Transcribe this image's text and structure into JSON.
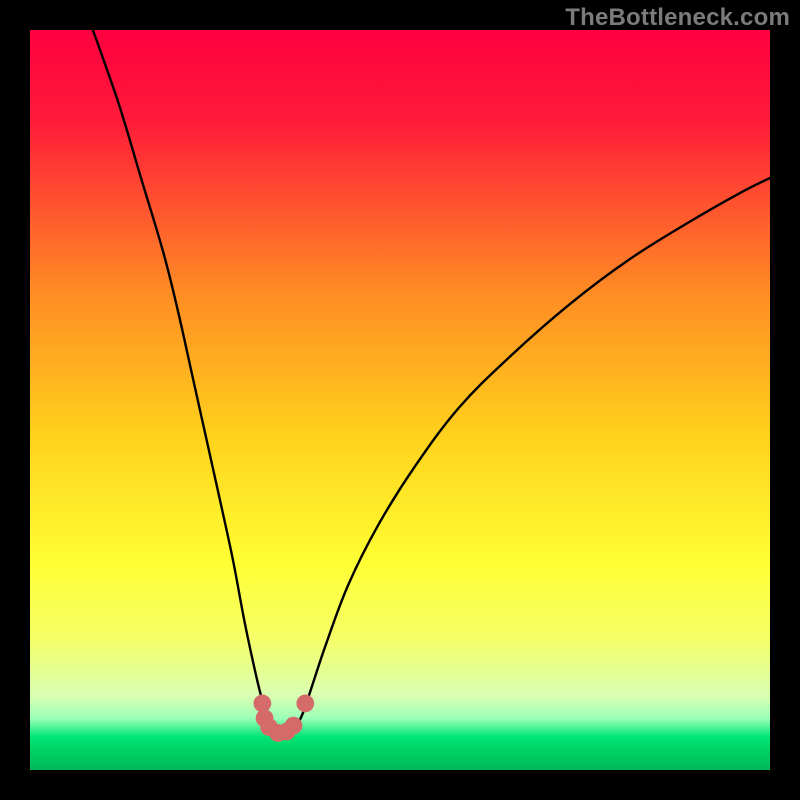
{
  "watermark": "TheBottleneck.com",
  "chart_data": {
    "type": "line",
    "title": "",
    "xlabel": "",
    "ylabel": "",
    "xlim": [
      0,
      100
    ],
    "ylim": [
      0,
      100
    ],
    "grid": false,
    "legend": false,
    "background_gradient": {
      "direction": "vertical",
      "stops": [
        {
          "pos": 0.0,
          "color": "#ff0040"
        },
        {
          "pos": 0.12,
          "color": "#ff1a3a"
        },
        {
          "pos": 0.35,
          "color": "#ff8a24"
        },
        {
          "pos": 0.55,
          "color": "#ffd21c"
        },
        {
          "pos": 0.72,
          "color": "#ffff33"
        },
        {
          "pos": 0.82,
          "color": "#f6ff66"
        },
        {
          "pos": 0.9,
          "color": "#d9ffb3"
        },
        {
          "pos": 0.93,
          "color": "#9dffb8"
        },
        {
          "pos": 0.955,
          "color": "#00e676"
        },
        {
          "pos": 0.97,
          "color": "#00d668"
        },
        {
          "pos": 1.0,
          "color": "#00b85a"
        }
      ]
    },
    "series": [
      {
        "name": "bottleneck-curve",
        "color": "#000000",
        "width": 2.4,
        "comment": "V-shaped curve; y is percentage (100=top). Minimum near x≈33 at y≈5.",
        "points": [
          {
            "x": 8.5,
            "y": 100
          },
          {
            "x": 12,
            "y": 90
          },
          {
            "x": 15,
            "y": 80
          },
          {
            "x": 18,
            "y": 70
          },
          {
            "x": 20,
            "y": 62
          },
          {
            "x": 22,
            "y": 53
          },
          {
            "x": 24,
            "y": 44
          },
          {
            "x": 26,
            "y": 35
          },
          {
            "x": 27.5,
            "y": 28
          },
          {
            "x": 29,
            "y": 20
          },
          {
            "x": 30.5,
            "y": 13
          },
          {
            "x": 31.5,
            "y": 9
          },
          {
            "x": 32.5,
            "y": 6
          },
          {
            "x": 33.5,
            "y": 5
          },
          {
            "x": 34.5,
            "y": 5
          },
          {
            "x": 36,
            "y": 6
          },
          {
            "x": 37,
            "y": 8
          },
          {
            "x": 38,
            "y": 11
          },
          {
            "x": 40,
            "y": 17
          },
          {
            "x": 43,
            "y": 25
          },
          {
            "x": 47,
            "y": 33
          },
          {
            "x": 52,
            "y": 41
          },
          {
            "x": 58,
            "y": 49
          },
          {
            "x": 65,
            "y": 56
          },
          {
            "x": 73,
            "y": 63
          },
          {
            "x": 81,
            "y": 69
          },
          {
            "x": 89,
            "y": 74
          },
          {
            "x": 96,
            "y": 78
          },
          {
            "x": 100,
            "y": 80
          }
        ]
      }
    ],
    "markers": [
      {
        "name": "dot",
        "x": 31.4,
        "y": 9.0,
        "r": 1.2,
        "color": "#d46a6a"
      },
      {
        "name": "dot",
        "x": 31.7,
        "y": 7.0,
        "r": 1.2,
        "color": "#d46a6a"
      },
      {
        "name": "dot",
        "x": 32.3,
        "y": 5.8,
        "r": 1.2,
        "color": "#d46a6a"
      },
      {
        "name": "dot",
        "x": 33.5,
        "y": 5.0,
        "r": 1.2,
        "color": "#d46a6a"
      },
      {
        "name": "dot",
        "x": 34.7,
        "y": 5.2,
        "r": 1.2,
        "color": "#d46a6a"
      },
      {
        "name": "dot",
        "x": 35.6,
        "y": 6.0,
        "r": 1.2,
        "color": "#d46a6a"
      },
      {
        "name": "dot",
        "x": 37.2,
        "y": 9.0,
        "r": 1.2,
        "color": "#d46a6a"
      }
    ]
  }
}
